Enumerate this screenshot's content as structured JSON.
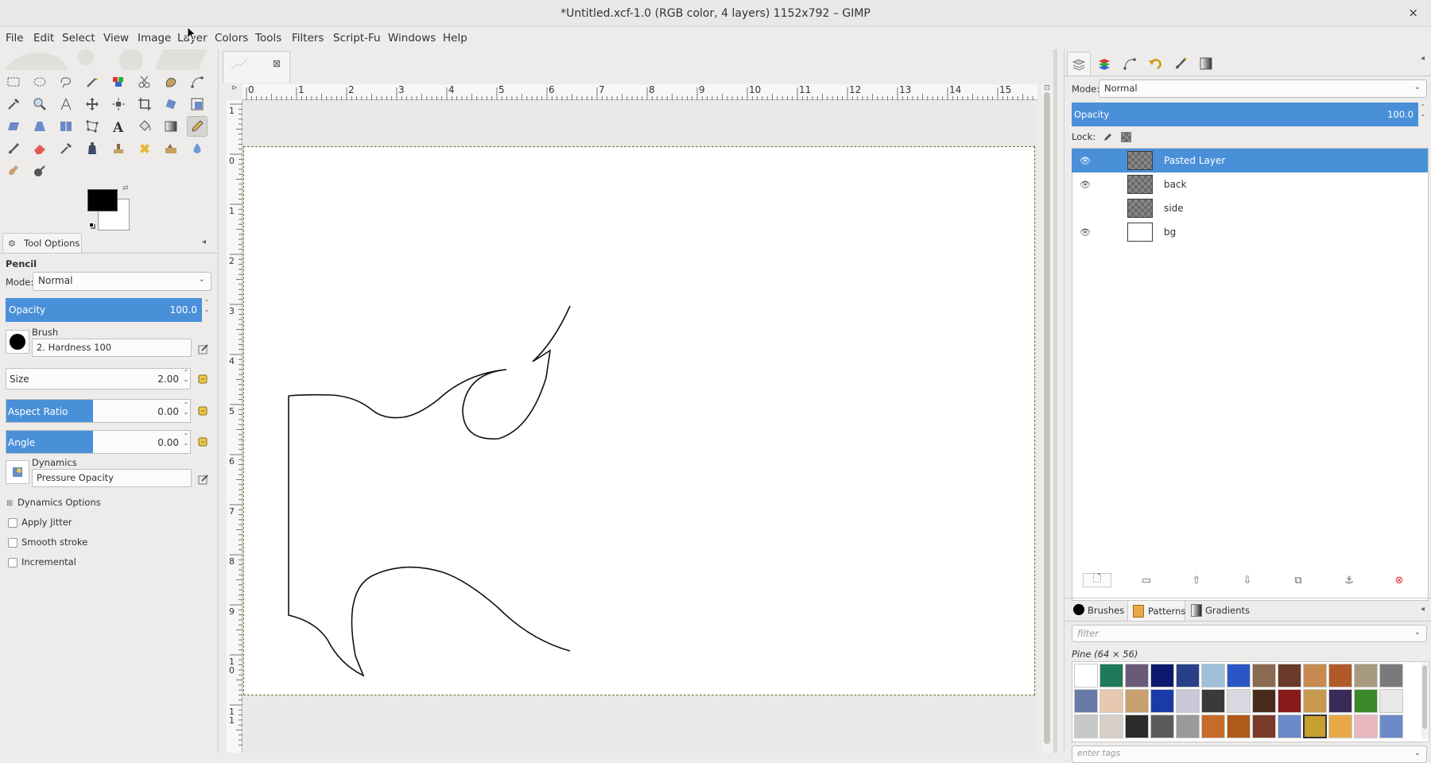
{
  "window": {
    "title": "*Untitled.xcf-1.0 (RGB color, 4 layers) 1152x792 – GIMP",
    "close_glyph": "×"
  },
  "menubar": [
    "File",
    "Edit",
    "Select",
    "View",
    "Image",
    "Layer",
    "Colors",
    "Tools",
    "Filters",
    "Script-Fu",
    "Windows",
    "Help"
  ],
  "tool_options": {
    "tab_label": "Tool Options",
    "tool_name": "Pencil",
    "mode_label": "Mode:",
    "mode_value": "Normal",
    "opacity_label": "Opacity",
    "opacity_value": "100.0",
    "brush_label": "Brush",
    "brush_value": "2. Hardness 100",
    "size_label": "Size",
    "size_value": "2.00",
    "aspect_label": "Aspect Ratio",
    "aspect_value": "0.00",
    "angle_label": "Angle",
    "angle_value": "0.00",
    "dynamics_label": "Dynamics",
    "dynamics_value": "Pressure Opacity",
    "dynamics_options_label": "Dynamics Options",
    "apply_jitter_label": "Apply Jitter",
    "smooth_stroke_label": "Smooth stroke",
    "incremental_label": "Incremental"
  },
  "rulers": {
    "horizontal_ticks": [
      "0",
      "1",
      "2",
      "3",
      "4",
      "5",
      "6",
      "7",
      "8",
      "9",
      "10",
      "11",
      "12",
      "13",
      "14",
      "15"
    ],
    "vertical_ticks": [
      "1",
      "0",
      "1",
      "2",
      "3",
      "4",
      "5",
      "6",
      "7",
      "8",
      "9",
      "10",
      "11"
    ]
  },
  "layers": {
    "mode_label": "Mode:",
    "mode_value": "Normal",
    "opacity_label": "Opacity",
    "opacity_value": "100.0",
    "lock_label": "Lock:",
    "items": [
      {
        "name": "Pasted Layer",
        "visible": true,
        "selected": true
      },
      {
        "name": "back",
        "visible": true,
        "selected": false
      },
      {
        "name": "side",
        "visible": false,
        "selected": false
      },
      {
        "name": "bg",
        "visible": true,
        "selected": false
      }
    ]
  },
  "patterns": {
    "tabs": [
      "Brushes",
      "Patterns",
      "Gradients"
    ],
    "filter_placeholder": "filter",
    "current": "Pine (64 × 56)",
    "tags_placeholder": "enter tags",
    "swatch_colors": [
      "#ffffff",
      "#1f7a5a",
      "#6a5a78",
      "#0c1a6e",
      "#2a3f8a",
      "#9fc0d8",
      "#2a56c8",
      "#8a6a50",
      "#6a3a2a",
      "#c88a50",
      "#b05a2a",
      "#a89a80",
      "#7a7a7a",
      "#6a7aa8",
      "#e8c8b0",
      "#c8a070",
      "#1a3aa8",
      "#c8c8d8",
      "#3a3a3a",
      "#d8d8e0",
      "#4a2a1a",
      "#8a1a1a",
      "#c89a50",
      "#3a2a5a",
      "#3a8a2a",
      "#e8e8e8",
      "#c8c8c8",
      "#d8d0c8",
      "#2a2a2a",
      "#5a5a5a",
      "#9a9a9a",
      "#c86a2a",
      "#b05a1a",
      "#7a3a2a",
      "#6a8ac8",
      "#c8a030",
      "#e8a848",
      "#e8b8c0",
      "#6a8ac8"
    ]
  }
}
